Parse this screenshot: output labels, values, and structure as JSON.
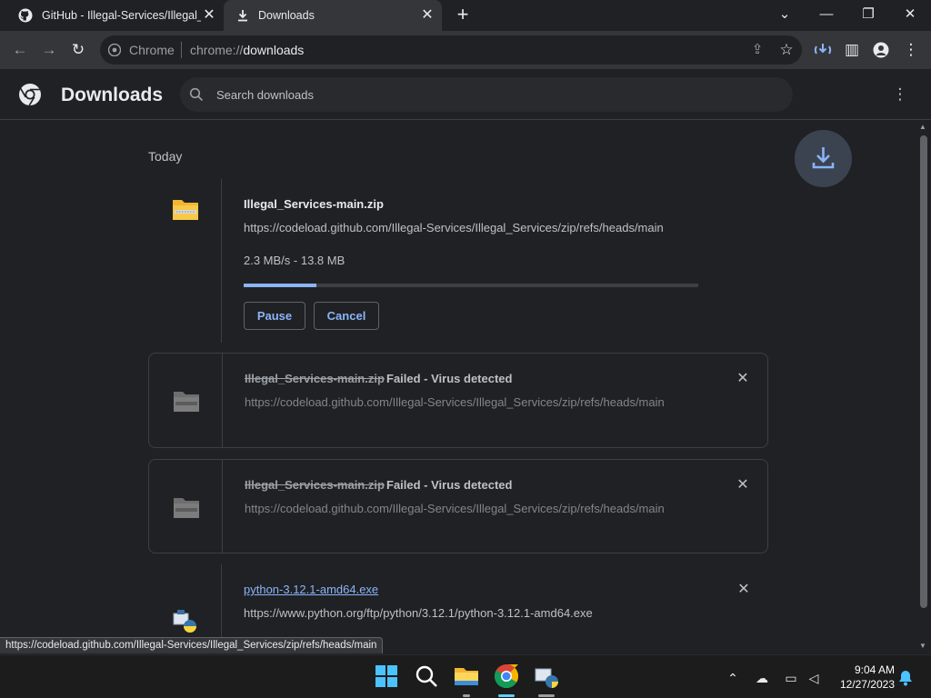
{
  "tabs": [
    {
      "title": "GitHub - Illegal-Services/Illegal_Services",
      "icon": "github-icon"
    },
    {
      "title": "Downloads",
      "icon": "download-icon",
      "active": true
    }
  ],
  "omnibox": {
    "site": "Chrome",
    "url_scheme": "chrome://",
    "url_host": "downloads"
  },
  "page": {
    "title": "Downloads",
    "search_placeholder": "Search downloads"
  },
  "date_group": "Today",
  "downloads": [
    {
      "name": "Illegal_Services-main.zip",
      "url": "https://codeload.github.com/Illegal-Services/Illegal_Services/zip/refs/heads/main",
      "progress_text": "2.3 MB/s - 13.8 MB",
      "progress_fraction": 0.16,
      "pause_label": "Pause",
      "cancel_label": "Cancel"
    },
    {
      "name": "Illegal_Services-main.zip",
      "status": "Failed - Virus detected",
      "url": "https://codeload.github.com/Illegal-Services/Illegal_Services/zip/refs/heads/main"
    },
    {
      "name": "Illegal_Services-main.zip",
      "status": "Failed - Virus detected",
      "url": "https://codeload.github.com/Illegal-Services/Illegal_Services/zip/refs/heads/main"
    },
    {
      "name": "python-3.12.1-amd64.exe",
      "url": "https://www.python.org/ftp/python/3.12.1/python-3.12.1-amd64.exe"
    }
  ],
  "status_bubble": "https://codeload.github.com/Illegal-Services/Illegal_Services/zip/refs/heads/main",
  "clock": {
    "time": "9:04 AM",
    "date": "12/27/2023"
  },
  "colors": {
    "accent": "#8ab4f8",
    "background": "#202124",
    "toolbar": "#35363a"
  }
}
